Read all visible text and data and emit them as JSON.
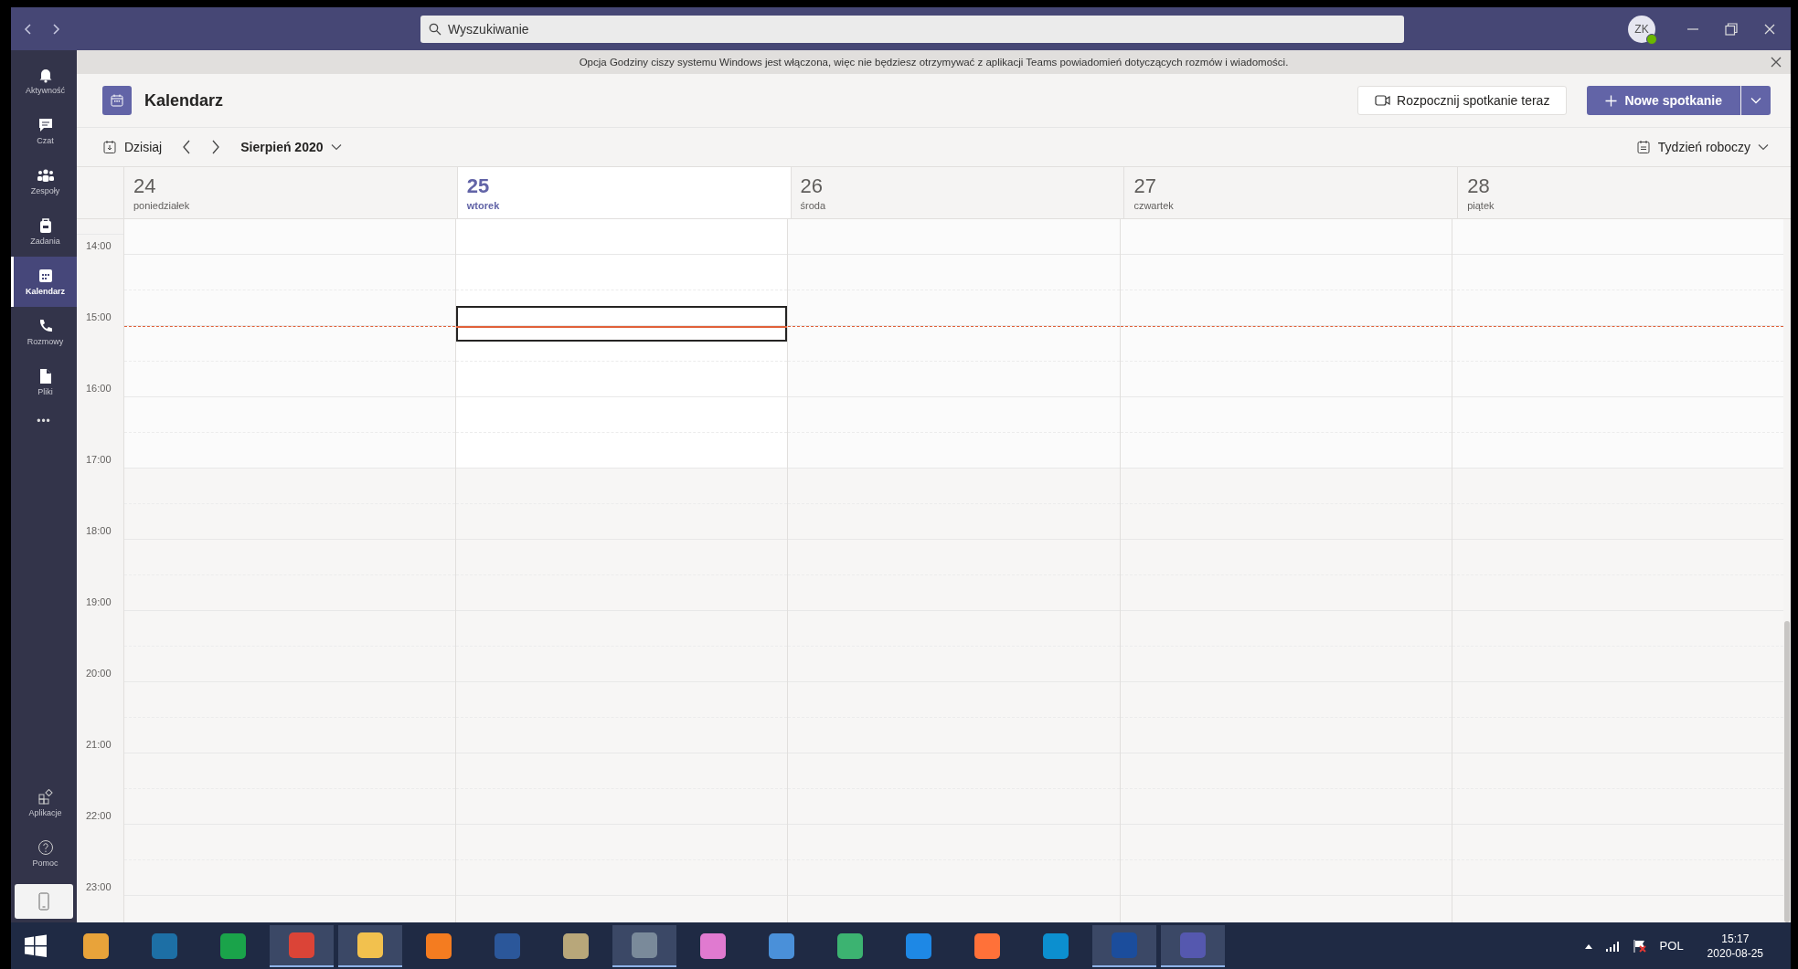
{
  "title_bar": {
    "search": {
      "placeholder": "Wyszukiwanie"
    },
    "avatar": {
      "initials": "ZK"
    }
  },
  "sidebar": {
    "items": [
      {
        "kind": "bell",
        "label": "Aktywność",
        "selected": false
      },
      {
        "kind": "chat",
        "label": "Czat",
        "selected": false
      },
      {
        "kind": "team",
        "label": "Zespoły",
        "selected": false
      },
      {
        "kind": "bag",
        "label": "Zadania",
        "selected": false
      },
      {
        "kind": "calendar",
        "label": "Kalendarz",
        "selected": true
      },
      {
        "kind": "phone",
        "label": "Rozmowy",
        "selected": false
      },
      {
        "kind": "file",
        "label": "Pliki",
        "selected": false
      }
    ],
    "more": "•••",
    "bottom_items": [
      {
        "kind": "apps",
        "label": "Aplikacje"
      },
      {
        "kind": "help",
        "label": "Pomoc"
      }
    ]
  },
  "notification": {
    "text": "Opcja Godziny ciszy systemu Windows jest włączona, więc nie będziesz otrzymywać z aplikacji Teams powiadomień dotyczących rozmów i wiadomości."
  },
  "header": {
    "title": "Kalendarz",
    "meet_now": "Rozpocznij spotkanie teraz",
    "new_meeting": "Nowe spotkanie"
  },
  "toolbar": {
    "today": "Dzisiaj",
    "month": "Sierpień 2020",
    "view": "Tydzień roboczy"
  },
  "days": [
    {
      "number": "24",
      "name": "poniedziałek",
      "selected": false
    },
    {
      "number": "25",
      "name": "wtorek",
      "selected": true
    },
    {
      "number": "26",
      "name": "środa",
      "selected": false
    },
    {
      "number": "27",
      "name": "czwartek",
      "selected": false
    },
    {
      "number": "28",
      "name": "piątek",
      "selected": false
    }
  ],
  "hours": [
    "14:00",
    "15:00",
    "16:00",
    "17:00",
    "18:00",
    "19:00",
    "20:00",
    "21:00",
    "22:00",
    "23:00"
  ],
  "taskbar": {
    "apps": [
      {
        "selected": false
      },
      {
        "selected": false
      },
      {
        "selected": false
      },
      {
        "selected": true
      },
      {
        "selected": true
      },
      {
        "selected": false
      },
      {
        "selected": false
      },
      {
        "selected": false
      },
      {
        "selected": true
      },
      {
        "selected": false
      },
      {
        "selected": false
      },
      {
        "selected": false
      },
      {
        "selected": false
      },
      {
        "selected": false
      },
      {
        "selected": false
      },
      {
        "selected": true
      },
      {
        "selected": true
      }
    ],
    "language": "POL",
    "time": "15:17",
    "date": "2020-08-25"
  }
}
